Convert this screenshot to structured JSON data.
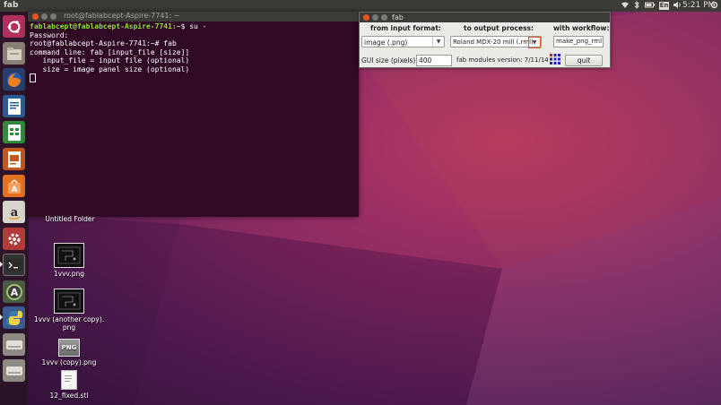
{
  "top_panel": {
    "title": "fab",
    "keyboard_indicator": "En",
    "clock": "5:21 PM"
  },
  "launcher": {
    "items": [
      {
        "name": "ubuntu-dash-icon"
      },
      {
        "name": "files-icon"
      },
      {
        "name": "firefox-icon"
      },
      {
        "name": "writer-icon"
      },
      {
        "name": "calc-icon"
      },
      {
        "name": "impress-icon"
      },
      {
        "name": "software-center-icon"
      },
      {
        "name": "amazon-icon"
      },
      {
        "name": "system-settings-icon"
      },
      {
        "name": "terminal-icon"
      },
      {
        "name": "software-updater-icon"
      },
      {
        "name": "python-icon"
      },
      {
        "name": "drive-icon"
      },
      {
        "name": "drive-2-icon"
      }
    ]
  },
  "terminal": {
    "title": "root@fablabcept-Aspire-7741: ~",
    "lines": {
      "line1_prompt": "fablabcept@fablabcept-Aspire-7741:",
      "line1_cmd": "~$ su -",
      "line2": "Password:",
      "line3": "root@fablabcept-Aspire-7741:~# fab",
      "line4": "command line: fab [input_file [size]]",
      "line5": "   input_file = input file (optional)",
      "line6": "   size = image panel size (optional)"
    }
  },
  "fab": {
    "title": "fab",
    "headers": {
      "input": "from input format:",
      "process": "to output process:",
      "workflow": "with workflow:"
    },
    "input_format": "image (.png)",
    "output_process": "Roland MDX-20 mill (.rml)",
    "workflow": "make_png_rml",
    "gui_size_label": "GUI size (pixels):",
    "gui_size_value": "400",
    "version": "fab modules version: 7/11/14",
    "quit_label": "quit"
  },
  "desktop": {
    "icons": [
      {
        "label": "Untitled Folder"
      },
      {
        "label": "1vvv.png"
      },
      {
        "label": "1vvv (another copy).\npng"
      },
      {
        "label": "1vvv (copy).png"
      },
      {
        "label": "12_fixed.stl"
      }
    ],
    "png_badge": "PNG"
  },
  "colors": {
    "terminal_bg": "#300a24",
    "prompt_green": "#8ae234",
    "panel_bg": "#3c3b37",
    "close_button": "#e95420"
  }
}
